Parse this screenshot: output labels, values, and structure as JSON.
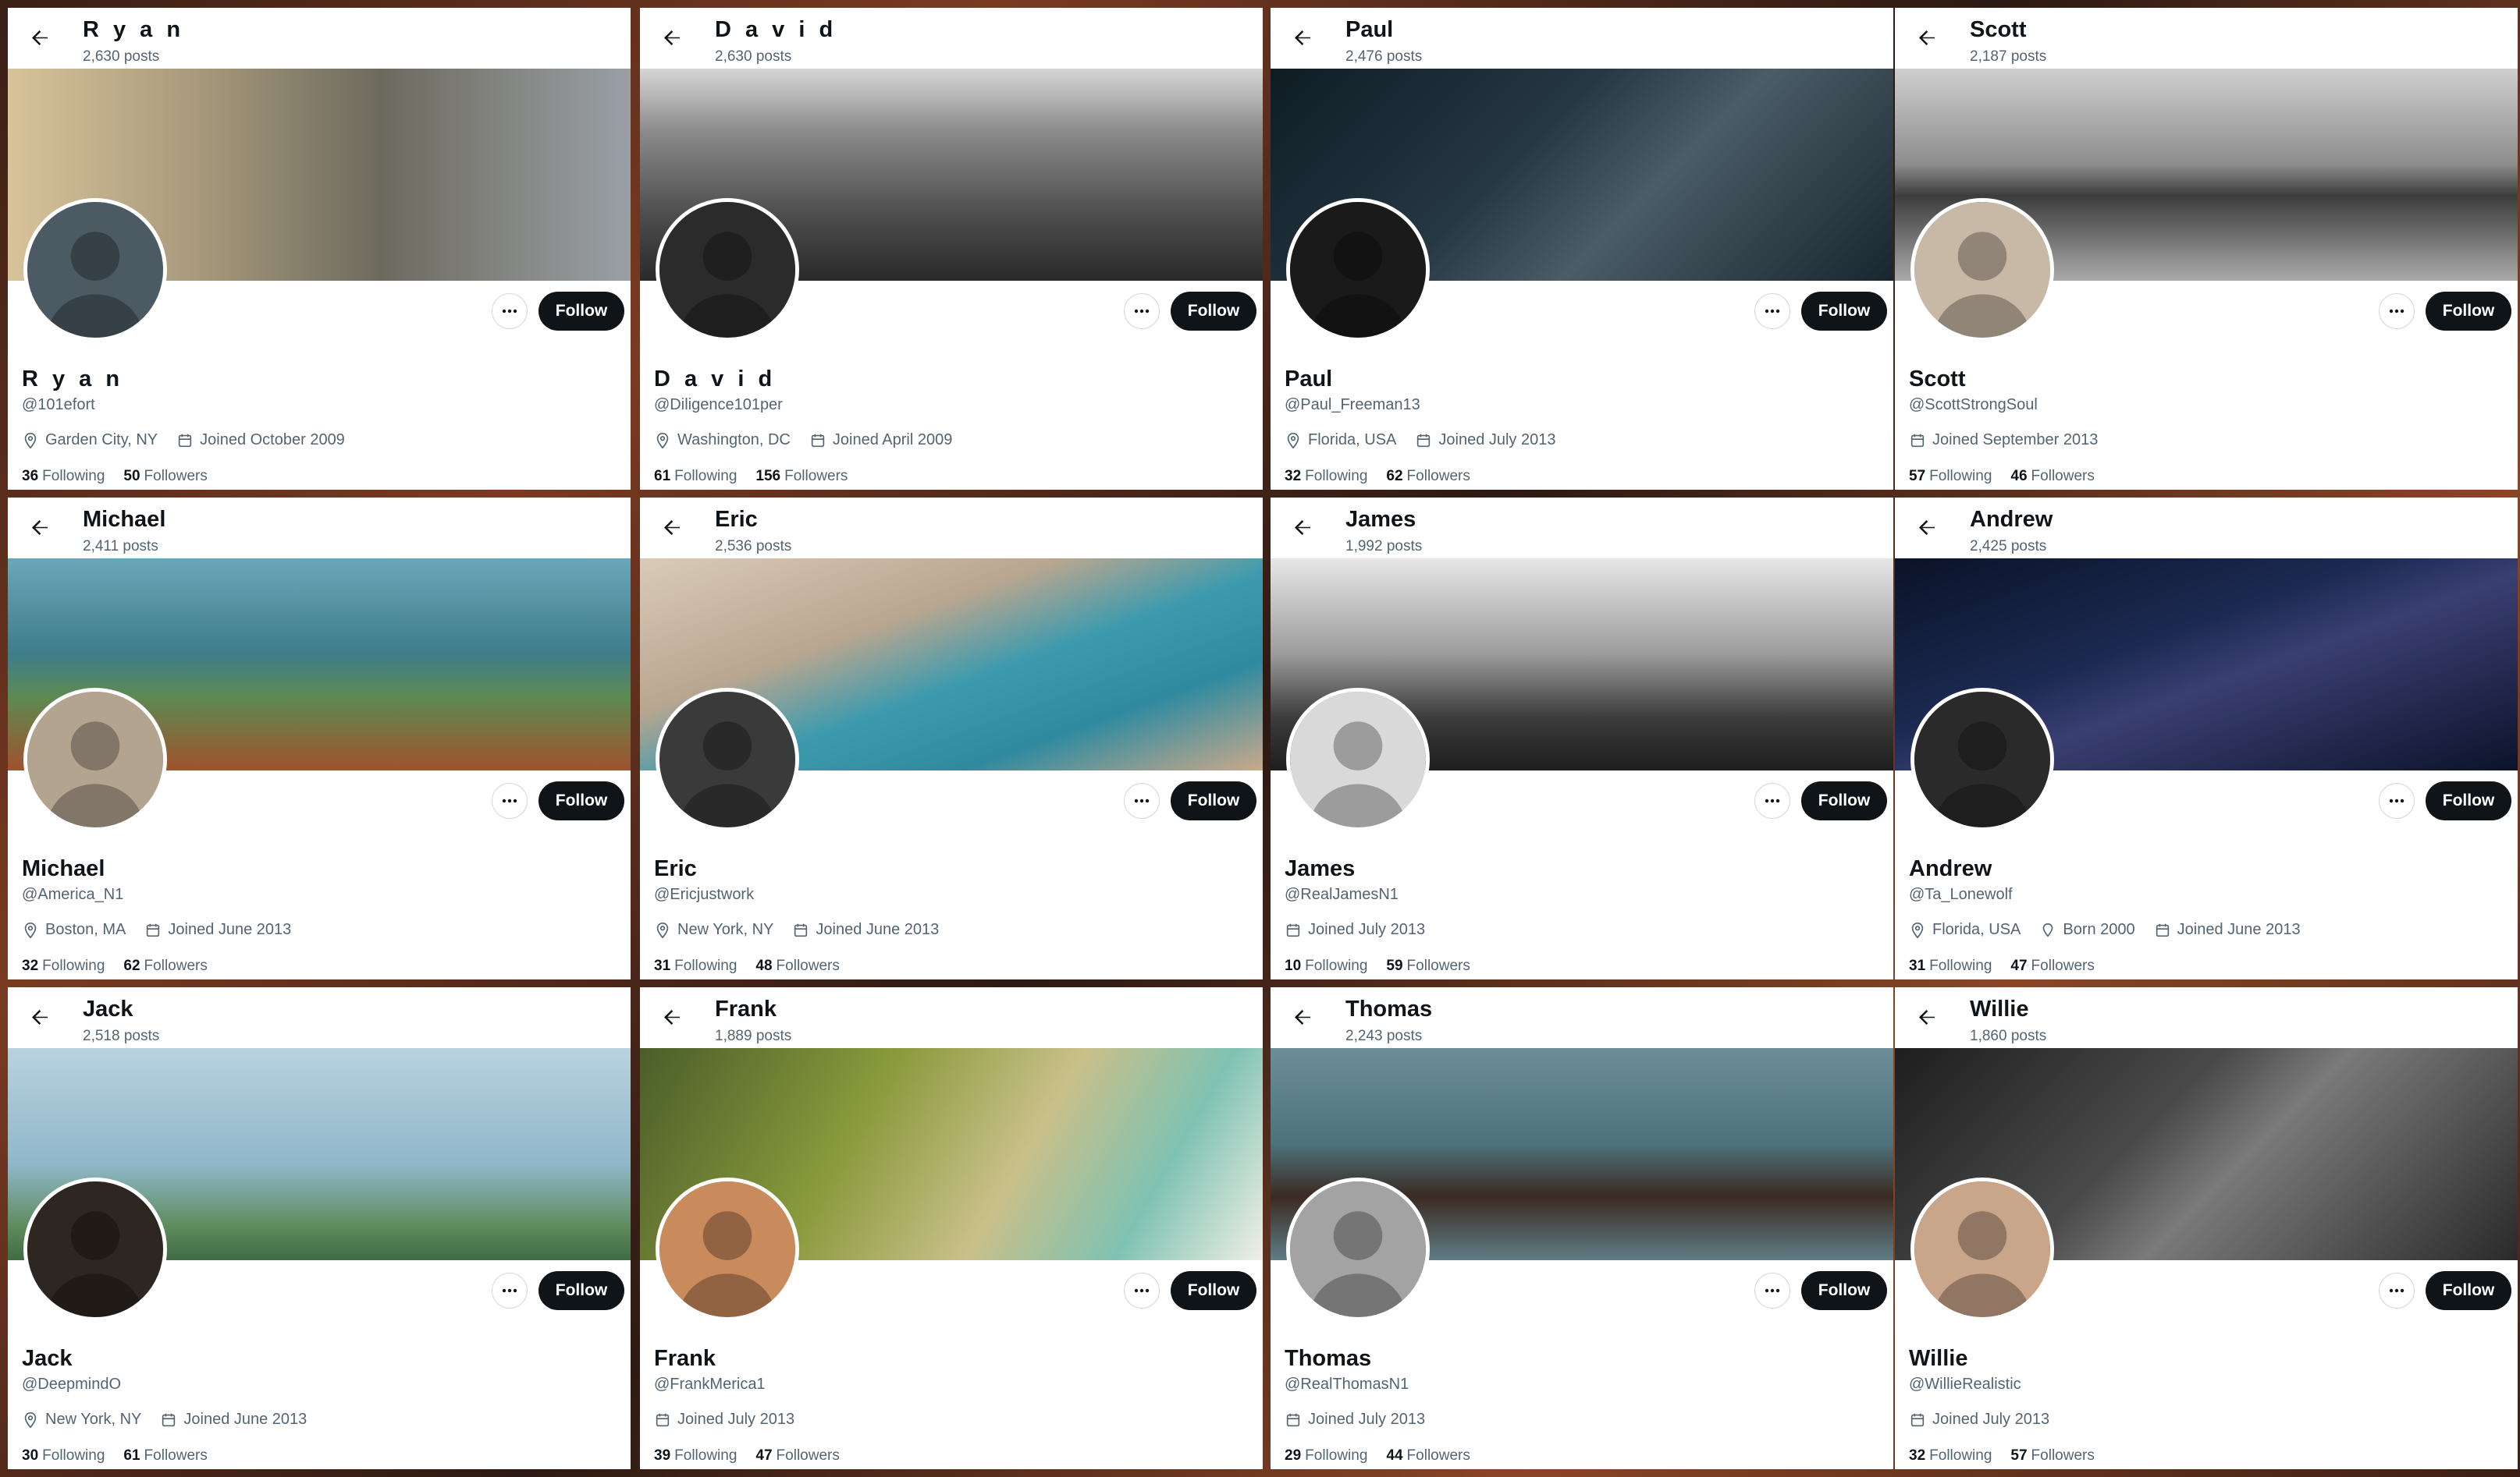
{
  "cards": [
    {
      "name": "R y a n",
      "posts": "2,630 posts",
      "handle": "@101efort",
      "location": "Garden City, NY",
      "born": "",
      "joined": "Joined October 2009",
      "following": "36",
      "followers": "50",
      "following_label": "Following",
      "followers_label": "Followers",
      "follow_label": "Follow",
      "banner_bg": "linear-gradient(90deg,#d8c39a 0%,#a99a7c 30%,#6d6a5e 60%,#9aa0a6 100%)",
      "avatar_bg": "#4b5a63"
    },
    {
      "name": "D a v i d",
      "posts": "2,630 posts",
      "handle": "@Diligence101per",
      "location": "Washington, DC",
      "born": "",
      "joined": "Joined April 2009",
      "following": "61",
      "followers": "156",
      "following_label": "Following",
      "followers_label": "Followers",
      "follow_label": "Follow",
      "banner_bg": "linear-gradient(180deg,#d6d6d6 0%,#8a8a8a 30%,#4c4c4c 70%,#2a2a2a 100%)",
      "avatar_bg": "#2b2b2b"
    },
    {
      "name": "Paul",
      "posts": "2,476 posts",
      "handle": "@Paul_Freeman13",
      "location": "Florida, USA",
      "born": "",
      "joined": "Joined July 2013",
      "following": "32",
      "followers": "62",
      "following_label": "Following",
      "followers_label": "Followers",
      "follow_label": "Follow",
      "banner_bg": "linear-gradient(135deg,#0f1c24 0%,#263844 40%,#4a5c66 60%,#18262e 100%)",
      "avatar_bg": "#1a1a1a"
    },
    {
      "name": "Scott",
      "posts": "2,187 posts",
      "handle": "@ScottStrongSoul",
      "location": "",
      "born": "",
      "joined": "Joined September 2013",
      "following": "57",
      "followers": "46",
      "following_label": "Following",
      "followers_label": "Followers",
      "follow_label": "Follow",
      "banner_bg": "linear-gradient(180deg,#cfcfcf 0%,#8d8d8d 45%,#3d3d3d 60%,#a9a9a9 100%)",
      "avatar_bg": "#c8b9a6"
    },
    {
      "name": "Michael",
      "posts": "2,411 posts",
      "handle": "@America_N1",
      "location": "Boston, MA",
      "born": "",
      "joined": "Joined June 2013",
      "following": "32",
      "followers": "62",
      "following_label": "Following",
      "followers_label": "Followers",
      "follow_label": "Follow",
      "banner_bg": "linear-gradient(180deg,#6aa7b8 0%,#3e7d8c 45%,#5d8a52 65%,#a0522d 100%)",
      "avatar_bg": "#b3a48f"
    },
    {
      "name": "Eric",
      "posts": "2,536 posts",
      "handle": "@Ericjustwork",
      "location": "New York, NY",
      "born": "",
      "joined": "Joined June 2013",
      "following": "31",
      "followers": "48",
      "following_label": "Following",
      "followers_label": "Followers",
      "follow_label": "Follow",
      "banner_bg": "linear-gradient(160deg,#d9cbb8 0%,#b9a690 35%,#3d9aae 55%,#2f8aa0 75%,#caa98a 100%)",
      "avatar_bg": "#3a3a3a"
    },
    {
      "name": "James",
      "posts": "1,992 posts",
      "handle": "@RealJamesN1",
      "location": "",
      "born": "",
      "joined": "Joined July 2013",
      "following": "10",
      "followers": "59",
      "following_label": "Following",
      "followers_label": "Followers",
      "follow_label": "Follow",
      "banner_bg": "linear-gradient(180deg,#e6e6e6 0%,#9c9c9c 45%,#3c3c3c 75%,#1e1e1e 100%)",
      "avatar_bg": "#d9d9d9"
    },
    {
      "name": "Andrew",
      "posts": "2,425 posts",
      "handle": "@Ta_Lonewolf",
      "location": "Florida, USA",
      "born": "Born 2000",
      "joined": "Joined June 2013",
      "following": "31",
      "followers": "47",
      "following_label": "Following",
      "followers_label": "Followers",
      "follow_label": "Follow",
      "banner_bg": "linear-gradient(160deg,#0b1328 0%,#1c2a52 40%,#3a3f72 55%,#0c132a 100%)",
      "avatar_bg": "#2a2a2a"
    },
    {
      "name": "Jack",
      "posts": "2,518 posts",
      "handle": "@DeepmindO",
      "location": "New York, NY",
      "born": "",
      "joined": "Joined June 2013",
      "following": "30",
      "followers": "61",
      "following_label": "Following",
      "followers_label": "Followers",
      "follow_label": "Follow",
      "banner_bg": "linear-gradient(180deg,#b9d2df 0%,#8fb7c9 55%,#5c8a5a 85%,#3f6b45 100%)",
      "avatar_bg": "#2e2620"
    },
    {
      "name": "Frank",
      "posts": "1,889 posts",
      "handle": "@FrankMerica1",
      "location": "",
      "born": "",
      "joined": "Joined July 2013",
      "following": "39",
      "followers": "47",
      "following_label": "Following",
      "followers_label": "Followers",
      "follow_label": "Follow",
      "banner_bg": "linear-gradient(120deg,#4a5e2a 0%,#8a9a3c 35%,#c9c08a 60%,#7fc2b2 80%,#f1efe6 100%)",
      "avatar_bg": "#c98a5c"
    },
    {
      "name": "Thomas",
      "posts": "2,243 posts",
      "handle": "@RealThomasN1",
      "location": "",
      "born": "",
      "joined": "Joined July 2013",
      "following": "29",
      "followers": "44",
      "following_label": "Following",
      "followers_label": "Followers",
      "follow_label": "Follow",
      "banner_bg": "linear-gradient(180deg,#6b8e98 0%,#4e727c 45%,#3b2a22 70%,#5f7e86 100%)",
      "avatar_bg": "#a3a3a3"
    },
    {
      "name": "Willie",
      "posts": "1,860 posts",
      "handle": "@WillieRealistic",
      "location": "",
      "born": "",
      "joined": "Joined July 2013",
      "following": "32",
      "followers": "57",
      "following_label": "Following",
      "followers_label": "Followers",
      "follow_label": "Follow",
      "banner_bg": "linear-gradient(135deg,#1e1e1e 0%,#4a4a4a 40%,#7a7a7a 55%,#2a2a2a 100%)",
      "avatar_bg": "#c9a58a"
    }
  ]
}
